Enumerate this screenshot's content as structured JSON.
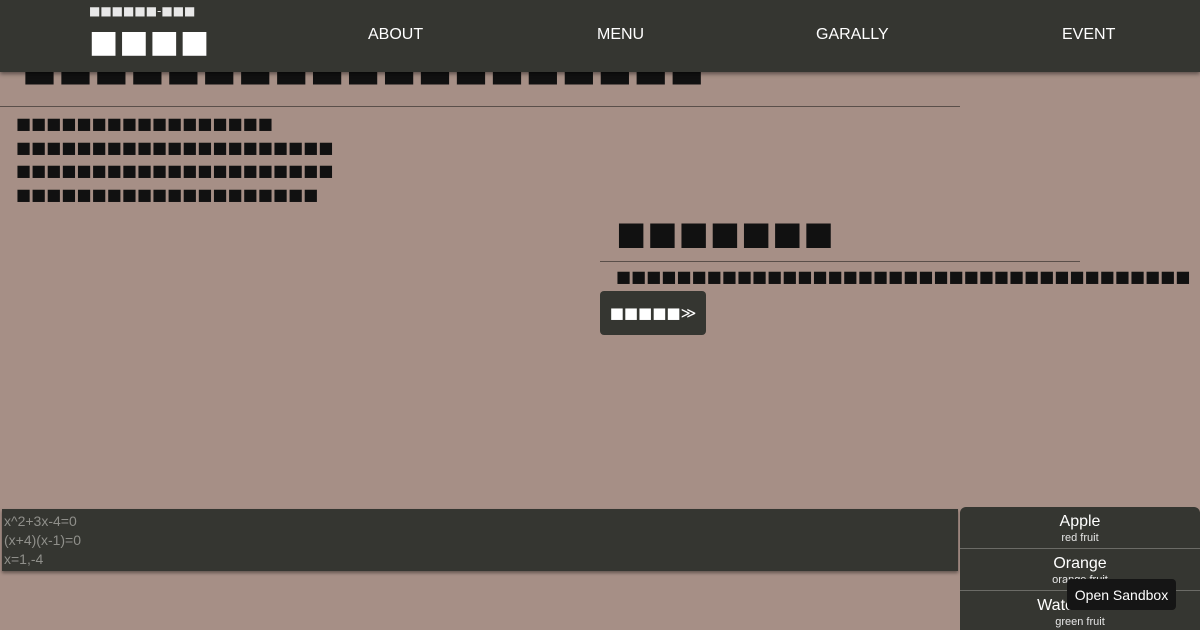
{
  "header": {
    "brand_sub": "■■■■■■-■■■",
    "brand_title": "■■■■",
    "nav": [
      "ABOUT",
      "MENU",
      "GARALLY",
      "EVENT"
    ]
  },
  "hero": {
    "heading": "■■■■■■■■■■■■■■■■■■■",
    "lines": [
      "■■■■■■■■■■■■■■■■■",
      "■■■■■■■■■■■■■■■■■■■■■",
      "■■■■■■■■■■■■■■■■■■■■■",
      "■■■■■■■■■■■■■■■■■■■■"
    ]
  },
  "section": {
    "title": "■■■■■■■",
    "text": "■■■■■■■■■■■■■■■■■■■■■■■■■■■■■■■■■■■■■■",
    "button_label": "■■■■■≫"
  },
  "math": {
    "lines": [
      "x^2+3x-4=0",
      "(x+4)(x-1)=0",
      "x=1,-4"
    ]
  },
  "fruits": [
    {
      "name": "Apple",
      "desc": "red fruit"
    },
    {
      "name": "Orange",
      "desc": "orange fruit"
    },
    {
      "name": "Watermelon",
      "desc": "green fruit"
    }
  ],
  "sandbox_button": "Open Sandbox",
  "colors": {
    "background": "#a68f86",
    "dark_panel": "#353631",
    "text_dark": "#111111"
  }
}
